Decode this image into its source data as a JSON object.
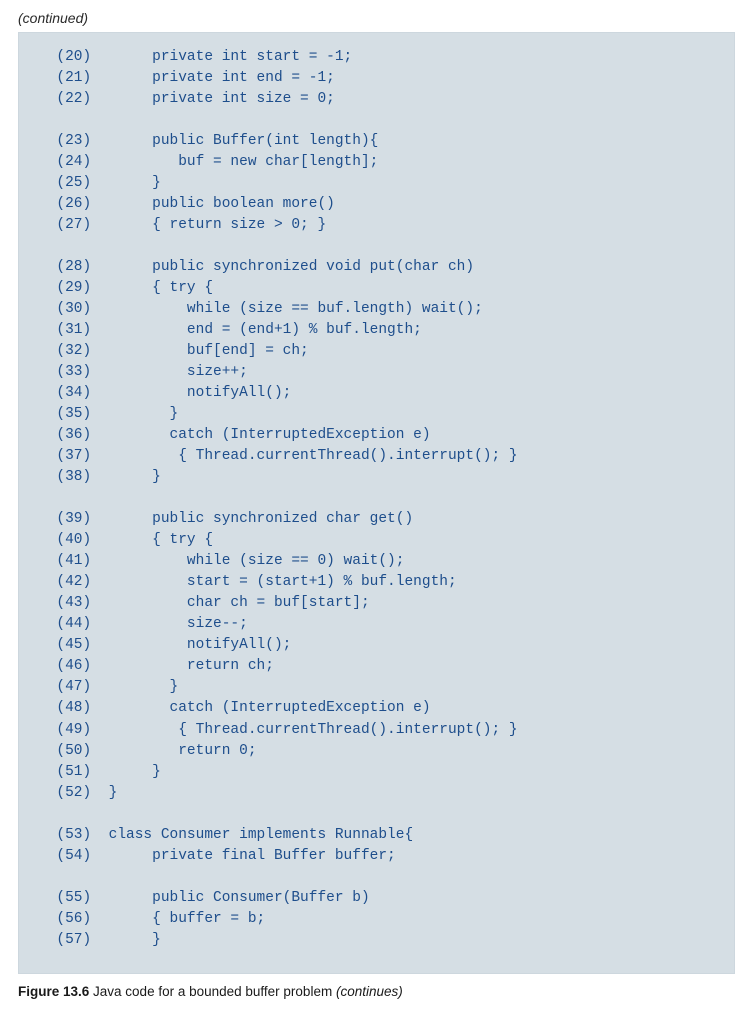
{
  "continued": "(continued)",
  "code": {
    "lines": [
      {
        "n": "(20)",
        "t": "      private int start = -1;"
      },
      {
        "n": "(21)",
        "t": "      private int end = -1;"
      },
      {
        "n": "(22)",
        "t": "      private int size = 0;"
      },
      {
        "n": "",
        "t": ""
      },
      {
        "n": "(23)",
        "t": "      public Buffer(int length){"
      },
      {
        "n": "(24)",
        "t": "         buf = new char[length];"
      },
      {
        "n": "(25)",
        "t": "      }"
      },
      {
        "n": "(26)",
        "t": "      public boolean more()"
      },
      {
        "n": "(27)",
        "t": "      { return size > 0; }"
      },
      {
        "n": "",
        "t": ""
      },
      {
        "n": "(28)",
        "t": "      public synchronized void put(char ch)"
      },
      {
        "n": "(29)",
        "t": "      { try {"
      },
      {
        "n": "(30)",
        "t": "          while (size == buf.length) wait();"
      },
      {
        "n": "(31)",
        "t": "          end = (end+1) % buf.length;"
      },
      {
        "n": "(32)",
        "t": "          buf[end] = ch;"
      },
      {
        "n": "(33)",
        "t": "          size++;"
      },
      {
        "n": "(34)",
        "t": "          notifyAll();"
      },
      {
        "n": "(35)",
        "t": "        }"
      },
      {
        "n": "(36)",
        "t": "        catch (InterruptedException e)"
      },
      {
        "n": "(37)",
        "t": "         { Thread.currentThread().interrupt(); }"
      },
      {
        "n": "(38)",
        "t": "      }"
      },
      {
        "n": "",
        "t": ""
      },
      {
        "n": "(39)",
        "t": "      public synchronized char get()"
      },
      {
        "n": "(40)",
        "t": "      { try {"
      },
      {
        "n": "(41)",
        "t": "          while (size == 0) wait();"
      },
      {
        "n": "(42)",
        "t": "          start = (start+1) % buf.length;"
      },
      {
        "n": "(43)",
        "t": "          char ch = buf[start];"
      },
      {
        "n": "(44)",
        "t": "          size--;"
      },
      {
        "n": "(45)",
        "t": "          notifyAll();"
      },
      {
        "n": "(46)",
        "t": "          return ch;"
      },
      {
        "n": "(47)",
        "t": "        }"
      },
      {
        "n": "(48)",
        "t": "        catch (InterruptedException e)"
      },
      {
        "n": "(49)",
        "t": "         { Thread.currentThread().interrupt(); }"
      },
      {
        "n": "(50)",
        "t": "         return 0;"
      },
      {
        "n": "(51)",
        "t": "      }"
      },
      {
        "n": "(52)",
        "t": " }"
      },
      {
        "n": "",
        "t": ""
      },
      {
        "n": "(53)",
        "t": " class Consumer implements Runnable{"
      },
      {
        "n": "(54)",
        "t": "      private final Buffer buffer;"
      },
      {
        "n": "",
        "t": ""
      },
      {
        "n": "(55)",
        "t": "      public Consumer(Buffer b)"
      },
      {
        "n": "(56)",
        "t": "      { buffer = b;"
      },
      {
        "n": "(57)",
        "t": "      }"
      }
    ]
  },
  "caption": {
    "label": "Figure 13.6",
    "body": " Java code for a bounded buffer problem ",
    "tail": "(continues)"
  }
}
